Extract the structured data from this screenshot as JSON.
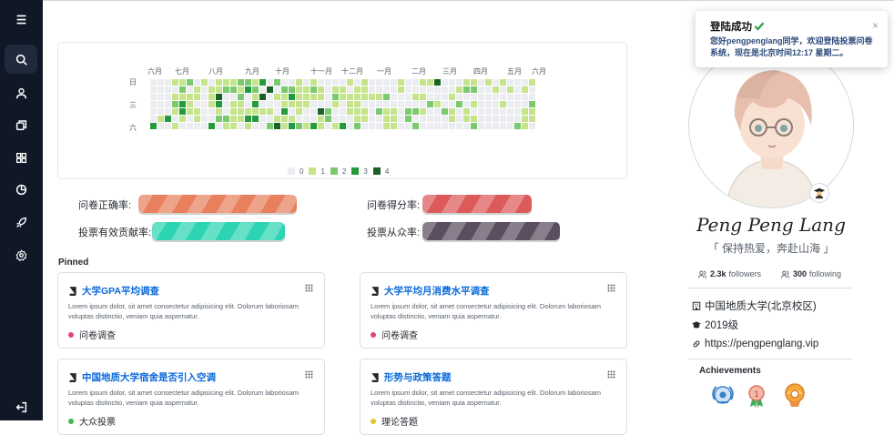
{
  "sidebar": {
    "items": [
      {
        "icon": "menu-icon"
      },
      {
        "icon": "search-icon",
        "active": true
      },
      {
        "icon": "user-icon"
      },
      {
        "icon": "copy-icon"
      },
      {
        "icon": "grid-icon"
      },
      {
        "icon": "pie-chart-icon"
      },
      {
        "icon": "rocket-icon"
      },
      {
        "icon": "settings-icon"
      },
      {
        "icon": "logout-icon"
      }
    ]
  },
  "heatmap": {
    "months": [
      "六月",
      "七月",
      "八月",
      "九月",
      "十月",
      "十一月",
      "十二月",
      "一月",
      "二月",
      "三月",
      "四月",
      "五月",
      "六月"
    ],
    "day_labels": [
      "日",
      "三",
      "六"
    ],
    "legend_levels": [
      "0",
      "1",
      "2",
      "3",
      "4"
    ],
    "colors": [
      "#ebedf0",
      "#c6e48b",
      "#7bc96f",
      "#239a3b",
      "#196127"
    ]
  },
  "rates": [
    {
      "label": "问卷正确率:",
      "color": "#e8805e",
      "value": 1.0
    },
    {
      "label": "问卷得分率:",
      "color": "#dc5a5a",
      "value": 1.0
    },
    {
      "label": "投票有效贡献率:",
      "color": "#2dd4b3",
      "value": 1.0
    },
    {
      "label": "投票从众率:",
      "color": "#5a4e5f",
      "value": 1.0
    }
  ],
  "pinned": {
    "title": "Pinned",
    "items": [
      {
        "title": "大学GPA平均调查",
        "desc": "Lorem ipsum dolor, sit amet consectetur adipisicing elit. Dolorum laboriosam voluptas distinctio, veniam quia aspernatur.",
        "tag": "问卷调查",
        "tag_color": "#e0457b"
      },
      {
        "title": "大学平均月消费水平调查",
        "desc": "Lorem ipsum dolor, sit amet consectetur adipisicing elit. Dolorum laboriosam voluptas distinctio, veniam quia aspernatur.",
        "tag": "问卷调查",
        "tag_color": "#e0457b"
      },
      {
        "title": "中国地质大学宿舍是否引入空调",
        "desc": "Lorem ipsum dolor, sit amet consectetur adipisicing elit. Dolorum laboriosam voluptas distinctio, veniam quia aspernatur.",
        "tag": "大众投票",
        "tag_color": "#3fb950"
      },
      {
        "title": "形势与政策答题",
        "desc": "Lorem ipsum dolor, sit amet consectetur adipisicing elit. Dolorum laboriosam voluptas distinctio, veniam quia aspernatur.",
        "tag": "理论答题",
        "tag_color": "#e3c32b"
      }
    ]
  },
  "profile": {
    "name": "Peng Peng Lang",
    "quote": "「 保持热爱，奔赴山海 」",
    "followers_count": "2.3k",
    "followers_label": "followers",
    "following_count": "300",
    "following_label": "following",
    "school": "中国地质大学(北京校区)",
    "grade": "2019级",
    "website": "https://pengpenglang.vip",
    "achievements_title": "Achievements"
  },
  "toast": {
    "title": "登陆成功",
    "message": "您好pengpenglang同学，欢迎登陆投票问卷系统，现在是北京时间12:17 星期二。",
    "close": "×"
  }
}
